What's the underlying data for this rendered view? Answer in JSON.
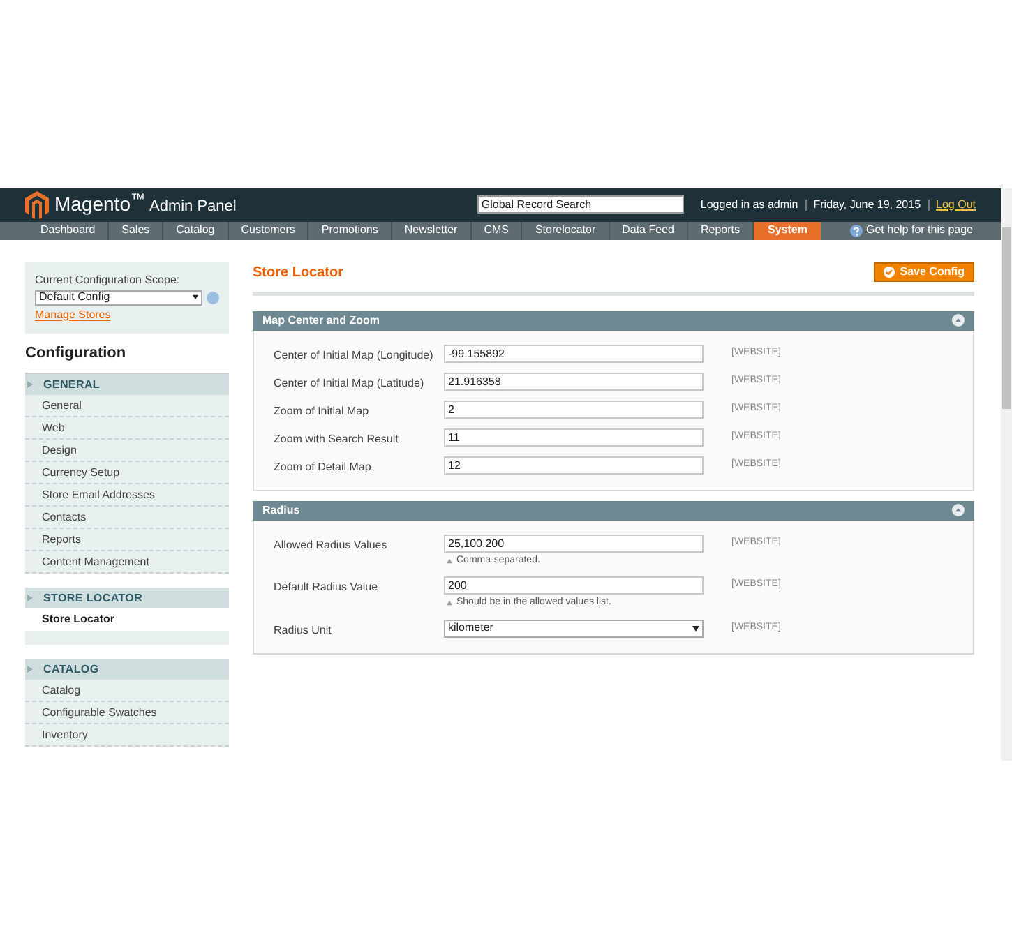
{
  "header": {
    "brand": "Magento$^{™}$",
    "product": "Admin Panel",
    "search": {
      "value": "Global Record Search"
    },
    "user": "Logged in as admin",
    "date": "Friday, June 19, 2015",
    "logout": "Log Out"
  },
  "nav": {
    "items": [
      {
        "label": "Dashboard",
        "selected": false
      },
      {
        "label": "Sales",
        "selected": false
      },
      {
        "label": "Catalog",
        "selected": false
      },
      {
        "label": "Customers",
        "selected": false
      },
      {
        "label": "Promotions",
        "selected": false
      },
      {
        "label": "Newsletter",
        "selected": false
      },
      {
        "label": "CMS",
        "selected": false
      },
      {
        "label": "Storelocator",
        "selected": false
      },
      {
        "label": "Data Feed",
        "selected": false
      },
      {
        "label": "Reports",
        "selected": false
      },
      {
        "label": "System",
        "selected": true
      }
    ],
    "help": "Get help for this page"
  },
  "sidebar": {
    "scope_label": "Current Configuration Scope:",
    "scope_value": "Default Config",
    "manage_stores": "Manage Stores",
    "title": "Configuration",
    "sections": [
      {
        "title": "GENERAL",
        "items": [
          {
            "label": "General",
            "selected": false
          },
          {
            "label": "Web",
            "selected": false
          },
          {
            "label": "Design",
            "selected": false
          },
          {
            "label": "Currency Setup",
            "selected": false
          },
          {
            "label": "Store Email Addresses",
            "selected": false
          },
          {
            "label": "Contacts",
            "selected": false
          },
          {
            "label": "Reports",
            "selected": false
          },
          {
            "label": "Content Management",
            "selected": false
          }
        ]
      },
      {
        "title": "STORE LOCATOR",
        "items": [
          {
            "label": "Store Locator",
            "selected": true
          }
        ]
      },
      {
        "title": "CATALOG",
        "items": [
          {
            "label": "Catalog",
            "selected": false
          },
          {
            "label": "Configurable Swatches",
            "selected": false
          },
          {
            "label": "Inventory",
            "selected": false
          }
        ]
      }
    ]
  },
  "main": {
    "title": "Store Locator",
    "save_button": "Save Config",
    "groups": [
      {
        "title": "Map Center and Zoom",
        "fields": [
          {
            "kind": "text",
            "label": "Center of Initial Map (Longitude)",
            "value": "-99.155892",
            "scope": "[WEBSITE]"
          },
          {
            "kind": "text",
            "label": "Center of Initial Map (Latitude)",
            "value": "21.916358",
            "scope": "[WEBSITE]"
          },
          {
            "kind": "text",
            "label": "Zoom of Initial Map",
            "value": "2",
            "scope": "[WEBSITE]"
          },
          {
            "kind": "text",
            "label": "Zoom with Search Result",
            "value": "11",
            "scope": "[WEBSITE]"
          },
          {
            "kind": "text",
            "label": "Zoom of Detail Map",
            "value": "12",
            "scope": "[WEBSITE]"
          }
        ]
      },
      {
        "title": "Radius",
        "fields": [
          {
            "kind": "text",
            "label": "Allowed Radius Values",
            "value": "25,100,200",
            "note": "Comma-separated.",
            "scope": "[WEBSITE]"
          },
          {
            "kind": "text",
            "label": "Default Radius Value",
            "value": "200",
            "note": "Should be in the allowed values list.",
            "scope": "[WEBSITE]"
          },
          {
            "kind": "select",
            "label": "Radius Unit",
            "value": "kilometer",
            "scope": "[WEBSITE]"
          }
        ]
      }
    ]
  }
}
